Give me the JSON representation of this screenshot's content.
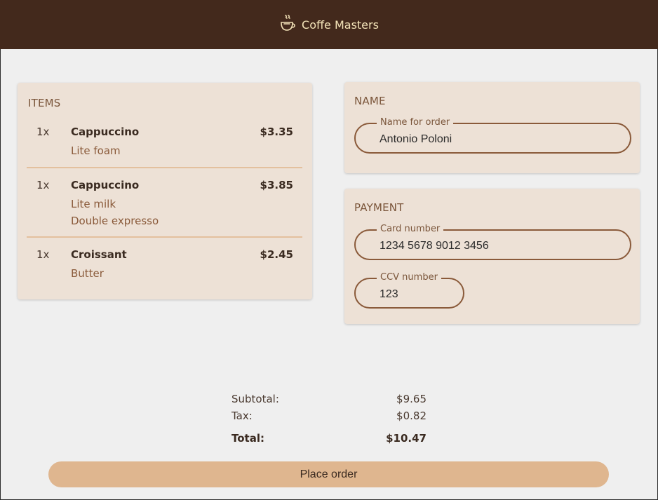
{
  "app": {
    "title": "Coffe Masters",
    "logo_icon": "coffee-cup-icon",
    "header_color": "#43291c",
    "accent_color": "#dfb68f"
  },
  "items": {
    "title": "ITEMS",
    "list": [
      {
        "qty": "1x",
        "name": "Cappuccino",
        "price": "$3.35",
        "modifiers": [
          "Lite foam"
        ]
      },
      {
        "qty": "1x",
        "name": "Cappuccino",
        "price": "$3.85",
        "modifiers": [
          "Lite milk",
          "Double expresso"
        ]
      },
      {
        "qty": "1x",
        "name": "Croissant",
        "price": "$2.45",
        "modifiers": [
          "Butter"
        ]
      }
    ]
  },
  "name_section": {
    "title": "NAME",
    "field_label": "Name for order",
    "field_value": "Antonio Poloni"
  },
  "payment": {
    "title": "PAYMENT",
    "card_label": "Card number",
    "card_value": "1234 5678 9012 3456",
    "ccv_label": "CCV number",
    "ccv_value": "123"
  },
  "totals": {
    "subtotal_label": "Subtotal:",
    "subtotal_value": "$9.65",
    "tax_label": "Tax:",
    "tax_value": "$0.82",
    "total_label": "Total:",
    "total_value": "$10.47"
  },
  "actions": {
    "place_order_label": "Place order"
  }
}
